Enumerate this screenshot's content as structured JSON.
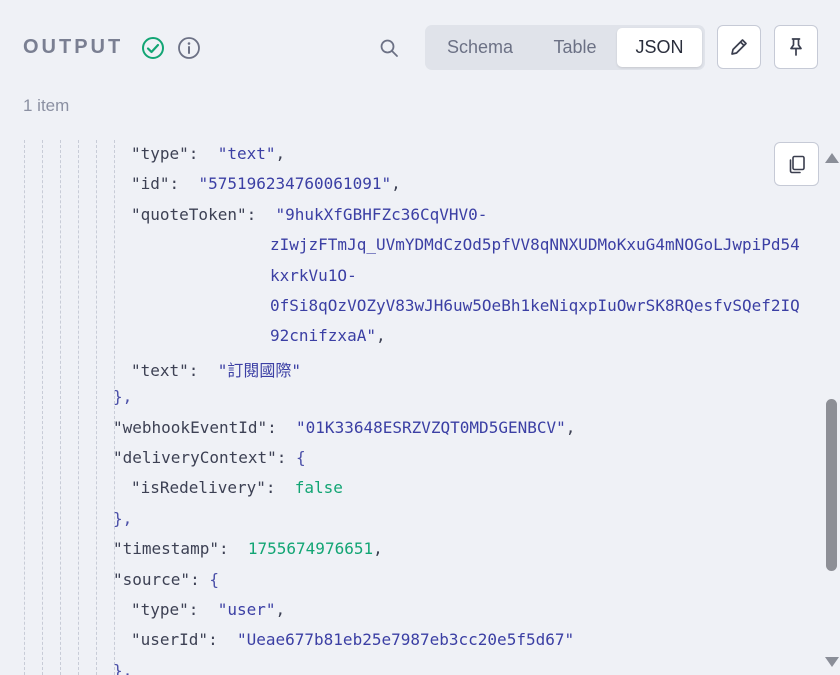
{
  "header": {
    "title": "OUTPUT",
    "tabs": [
      {
        "label": "Schema",
        "active": false
      },
      {
        "label": "Table",
        "active": false
      },
      {
        "label": "JSON",
        "active": true
      }
    ]
  },
  "item_count": "1 item",
  "colors": {
    "success": "#12a574",
    "string": "#3b3fa4",
    "key": "#3d4154",
    "background": "#eff1f6"
  },
  "icons": [
    "check-circle-icon",
    "info-icon",
    "search-icon",
    "pencil-icon",
    "pin-icon",
    "copy-icon"
  ],
  "json_lines": [
    {
      "parts": [
        {
          "t": "\"type\"",
          "c": "k"
        },
        {
          "t": ":  ",
          "c": "k"
        },
        {
          "t": "\"text\"",
          "c": "s"
        },
        {
          "t": ",",
          "c": "k"
        }
      ]
    },
    {
      "parts": [
        {
          "t": "\"id\"",
          "c": "k"
        },
        {
          "t": ":  ",
          "c": "k"
        },
        {
          "t": "\"575196234760061091\"",
          "c": "s"
        },
        {
          "t": ",",
          "c": "k"
        }
      ]
    },
    {
      "parts": [
        {
          "t": "\"quoteToken\"",
          "c": "k"
        },
        {
          "t": ":  ",
          "c": "k"
        },
        {
          "t": "\"9hukXfGBHFZc36CqVHV0-",
          "c": "s"
        }
      ]
    },
    {
      "parts": [
        {
          "t": "zIwjzFTmJq_UVmYDMdCzOd5pfVV8qNNXUDMoKxuG4mNOGoLJwpiPd54",
          "c": "s"
        }
      ]
    },
    {
      "parts": [
        {
          "t": "kxrkVu1O-",
          "c": "s"
        }
      ]
    },
    {
      "parts": [
        {
          "t": "0fSi8qOzVOZyV83wJH6uw5OeBh1keNiqxpIuOwrSK8RQesfvSQef2IQ",
          "c": "s"
        }
      ]
    },
    {
      "parts": [
        {
          "t": "92cnifzxaA\"",
          "c": "s"
        },
        {
          "t": ",",
          "c": "k"
        }
      ]
    },
    {
      "parts": [
        {
          "t": "\"text\"",
          "c": "k"
        },
        {
          "t": ":  ",
          "c": "k"
        },
        {
          "t": "\"訂閱國際\"",
          "c": "s"
        }
      ]
    },
    {
      "parts": [
        {
          "t": "},",
          "c": "p"
        }
      ]
    },
    {
      "parts": [
        {
          "t": "\"webhookEventId\"",
          "c": "k"
        },
        {
          "t": ":  ",
          "c": "k"
        },
        {
          "t": "\"01K33648ESRZVZQT0MD5GENBCV\"",
          "c": "s"
        },
        {
          "t": ",",
          "c": "k"
        }
      ]
    },
    {
      "parts": [
        {
          "t": "\"deliveryContext\"",
          "c": "k"
        },
        {
          "t": ": ",
          "c": "k"
        },
        {
          "t": "{",
          "c": "p"
        }
      ]
    },
    {
      "parts": [
        {
          "t": "\"isRedelivery\"",
          "c": "k"
        },
        {
          "t": ":  ",
          "c": "k"
        },
        {
          "t": "false",
          "c": "b"
        }
      ]
    },
    {
      "parts": [
        {
          "t": "},",
          "c": "p"
        }
      ]
    },
    {
      "parts": [
        {
          "t": "\"timestamp\"",
          "c": "k"
        },
        {
          "t": ":  ",
          "c": "k"
        },
        {
          "t": "1755674976651",
          "c": "n"
        },
        {
          "t": ",",
          "c": "k"
        }
      ]
    },
    {
      "parts": [
        {
          "t": "\"source\"",
          "c": "k"
        },
        {
          "t": ": ",
          "c": "k"
        },
        {
          "t": "{",
          "c": "p"
        }
      ]
    },
    {
      "parts": [
        {
          "t": "\"type\"",
          "c": "k"
        },
        {
          "t": ":  ",
          "c": "k"
        },
        {
          "t": "\"user\"",
          "c": "s"
        },
        {
          "t": ",",
          "c": "k"
        }
      ]
    },
    {
      "parts": [
        {
          "t": "\"userId\"",
          "c": "k"
        },
        {
          "t": ":  ",
          "c": "k"
        },
        {
          "t": "\"Ueae677b81eb25e7987eb3cc20e5f5d67\"",
          "c": "s"
        }
      ]
    },
    {
      "parts": [
        {
          "t": "},",
          "c": "p"
        }
      ]
    }
  ]
}
